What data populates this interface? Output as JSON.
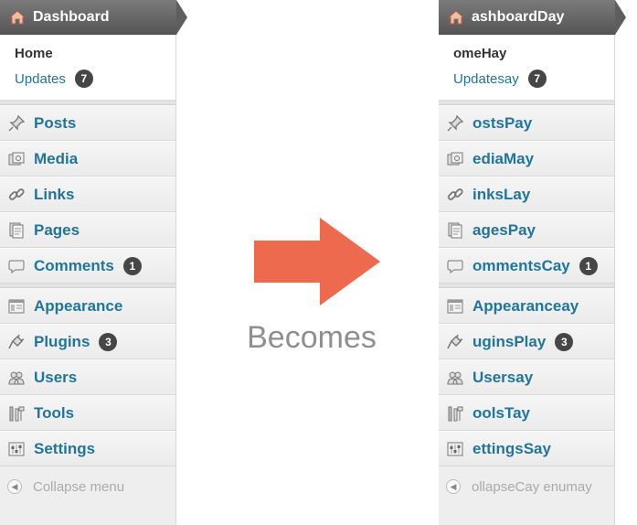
{
  "left": {
    "title": "Dashboard",
    "home": "Home",
    "updates": "Updates",
    "updates_badge": "7",
    "items": [
      {
        "label": "Posts"
      },
      {
        "label": "Media"
      },
      {
        "label": "Links"
      },
      {
        "label": "Pages"
      },
      {
        "label": "Comments",
        "badge": "1"
      },
      {
        "label": "Appearance"
      },
      {
        "label": "Plugins",
        "badge": "3"
      },
      {
        "label": "Users"
      },
      {
        "label": "Tools"
      },
      {
        "label": "Settings"
      }
    ],
    "collapse": "Collapse menu"
  },
  "right": {
    "title": "ashboardDay",
    "home": "omeHay",
    "updates": "Updatesay",
    "updates_badge": "7",
    "items": [
      {
        "label": "ostsPay"
      },
      {
        "label": "ediaMay"
      },
      {
        "label": "inksLay"
      },
      {
        "label": "agesPay"
      },
      {
        "label": "ommentsCay",
        "badge": "1"
      },
      {
        "label": "Appearanceay"
      },
      {
        "label": "uginsPlay",
        "badge": "3"
      },
      {
        "label": "Usersay"
      },
      {
        "label": "oolsTay"
      },
      {
        "label": "ettingsSay"
      }
    ],
    "collapse": "ollapseCay enumay"
  },
  "center_text": "Becomes",
  "colors": {
    "accent": "#21759b",
    "arrow": "#ed6a4f",
    "header": "#616161"
  },
  "icons": [
    "home-icon",
    "pushpin-icon",
    "media-icon",
    "link-icon",
    "pages-icon",
    "comment-icon",
    "appearance-icon",
    "plugin-icon",
    "users-icon",
    "tools-icon",
    "settings-icon",
    "collapse-icon"
  ]
}
